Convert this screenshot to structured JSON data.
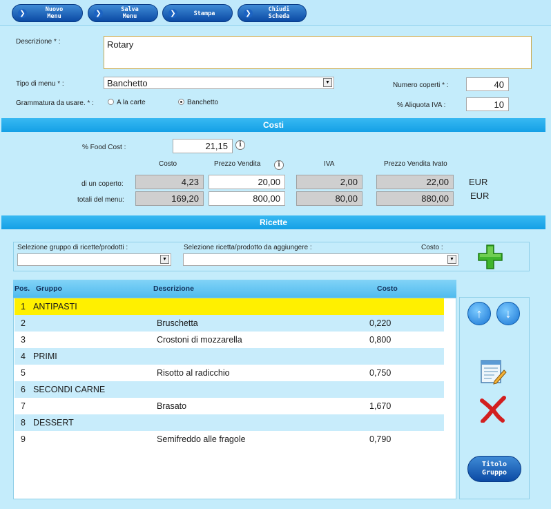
{
  "toolbar": {
    "buttons": [
      {
        "label": "Nuovo\nMenu"
      },
      {
        "label": "Salva\nMenu"
      },
      {
        "label": "Stampa"
      },
      {
        "label": "Chiudi\nScheda"
      }
    ]
  },
  "form": {
    "descrizione_label": "Descrizione * :",
    "descrizione_value": "Rotary",
    "tipo_label": "Tipo di menu * :",
    "tipo_value": "Banchetto",
    "grammatura_label": "Grammatura da usare. * :",
    "radio_alacarte": "A la carte",
    "radio_banchetto": "Banchetto",
    "coperti_label": "Numero coperti * :",
    "coperti_value": "40",
    "iva_label": "% Aliquota IVA :",
    "iva_value": "10"
  },
  "costi": {
    "title": "Costi",
    "food_cost_label": "% Food Cost :",
    "food_cost_value": "21,15",
    "headers": {
      "costo": "Costo",
      "prezzo": "Prezzo Vendita",
      "iva": "IVA",
      "ivato": "Prezzo Vendita Ivato"
    },
    "row_coperto": {
      "label": "di un coperto:",
      "costo": "4,23",
      "prezzo": "20,00",
      "iva": "2,00",
      "ivato": "22,00",
      "currency": "EUR"
    },
    "row_totali": {
      "label": "totali del menu:",
      "costo": "169,20",
      "prezzo": "800,00",
      "iva": "80,00",
      "ivato": "880,00",
      "currency": "EUR"
    }
  },
  "ricette": {
    "title": "Ricette",
    "gruppo_label": "Selezione gruppo di ricette/prodotti :",
    "ricetta_label": "Selezione ricetta/prodotto da aggiungere :",
    "costo_label": "Costo :",
    "columns": {
      "pos": "Pos.",
      "gruppo": "Gruppo",
      "descrizione": "Descrizione",
      "costo": "Costo"
    },
    "rows": [
      {
        "pos": "1",
        "gruppo": "ANTIPASTI",
        "descrizione": "",
        "costo": ""
      },
      {
        "pos": "2",
        "gruppo": "",
        "descrizione": "Bruschetta",
        "costo": "0,220"
      },
      {
        "pos": "3",
        "gruppo": "",
        "descrizione": "Crostoni di mozzarella",
        "costo": "0,800"
      },
      {
        "pos": "4",
        "gruppo": "PRIMI",
        "descrizione": "",
        "costo": ""
      },
      {
        "pos": "5",
        "gruppo": "",
        "descrizione": "Risotto al radicchio",
        "costo": "0,750"
      },
      {
        "pos": "6",
        "gruppo": "SECONDI CARNE",
        "descrizione": "",
        "costo": ""
      },
      {
        "pos": "7",
        "gruppo": "",
        "descrizione": "Brasato",
        "costo": "1,670"
      },
      {
        "pos": "8",
        "gruppo": "DESSERT",
        "descrizione": "",
        "costo": ""
      },
      {
        "pos": "9",
        "gruppo": "",
        "descrizione": "Semifreddo alle fragole",
        "costo": "0,790"
      }
    ],
    "titolo_gruppo_button": "Titolo\nGruppo"
  },
  "colors": {
    "band": "#14a0e6",
    "selected_row": "#fff000",
    "alt_row": "#c8ecfb",
    "background": "#c4ecfb"
  }
}
